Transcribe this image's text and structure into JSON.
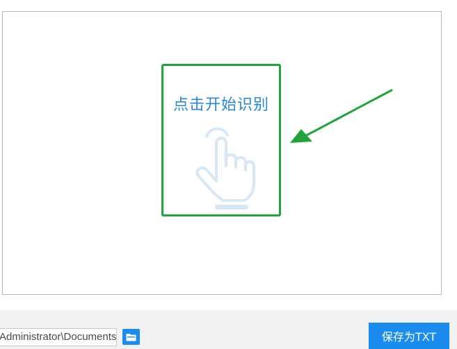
{
  "recognize": {
    "label": "点击开始识别",
    "icon": "hand-pointer-icon"
  },
  "footer": {
    "path_value": "Administrator\\Documents",
    "folder_icon": "folder-icon",
    "save_label": "保存为TXT"
  },
  "colors": {
    "accent": "#1a8cf0",
    "highlight": "#1fa33a",
    "label_blue": "#2a86d6"
  }
}
